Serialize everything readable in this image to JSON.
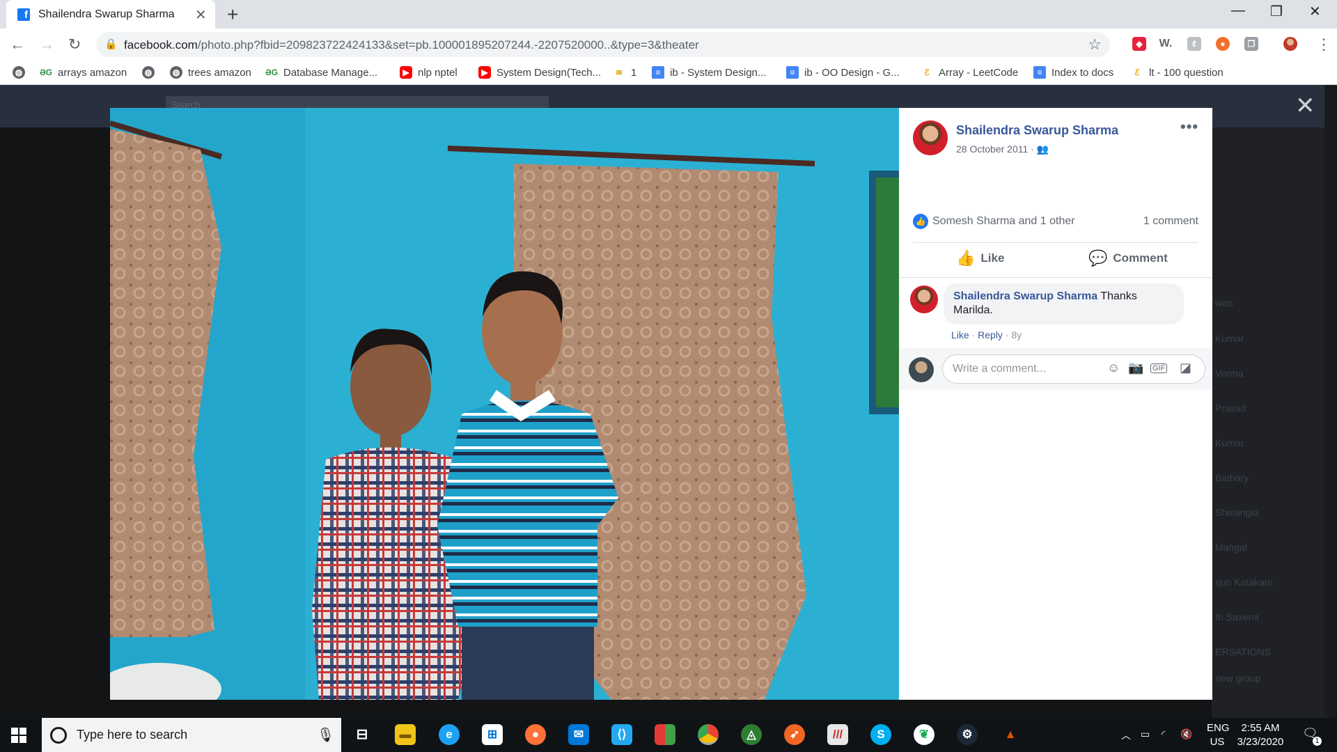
{
  "browser": {
    "tab_title": "Shailendra Swarup Sharma",
    "tab_favicon": "f",
    "url_domain": "facebook.com",
    "url_path": "/photo.php?fbid=209823722424133&set=pb.100001895207244.-2207520000..&type=3&theater",
    "extension_w": "W."
  },
  "bookmarks": [
    {
      "label": "arrays amazon",
      "icon": "gfg-icon"
    },
    {
      "label": "trees amazon",
      "icon": "gfg-icon"
    },
    {
      "label": "Database Manage...",
      "icon": "gfg-icon"
    },
    {
      "label": "nlp nptel",
      "icon": "youtube-icon"
    },
    {
      "label": "System Design(Tech...",
      "icon": "youtube-icon"
    },
    {
      "label": "1",
      "icon": "stackoverflow-icon"
    },
    {
      "label": "ib - System Design...",
      "icon": "docs-icon"
    },
    {
      "label": "ib - OO Design - G...",
      "icon": "docs-icon"
    },
    {
      "label": "Array - LeetCode",
      "icon": "leetcode-icon"
    },
    {
      "label": "Index to docs",
      "icon": "docs-icon"
    },
    {
      "label": "lt - 100 question",
      "icon": "leetcode-icon"
    }
  ],
  "facebook": {
    "search_placeholder": "Search",
    "sidebar_names": [
      "wan",
      "Kumar",
      "Verma",
      "Prasad",
      "Kumar",
      "Bathary",
      "Shelangia",
      "Mangal",
      "rjun Katakam",
      "th Saxena",
      "ERSATIONS",
      "new group"
    ]
  },
  "post": {
    "author": "Shailendra Swarup Sharma",
    "date": "28 October 2011",
    "reactions_text": "Somesh Sharma and 1 other",
    "comment_count": "1 comment",
    "like_label": "Like",
    "comment_label": "Comment"
  },
  "comment": {
    "author": "Shailendra Swarup Sharma",
    "text": "Thanks Marilda.",
    "like": "Like",
    "reply": "Reply",
    "age": "8y"
  },
  "write_comment_placeholder": "Write a comment...",
  "taskbar": {
    "search_placeholder": "Type here to search",
    "lang_top": "ENG",
    "lang_bottom": "US",
    "time": "2:55 AM",
    "date": "3/23/2020",
    "notification_count": "1"
  },
  "colors": {
    "facebook_blue": "#385898",
    "like_blue": "#2078f4",
    "wall": "#2bb0d4"
  }
}
